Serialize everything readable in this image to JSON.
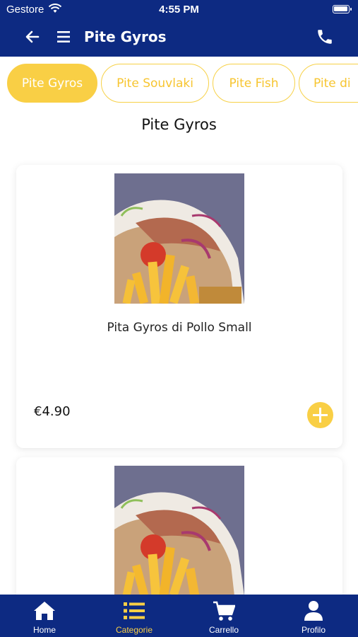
{
  "status_bar": {
    "carrier": "Gestore",
    "time": "4:55 PM"
  },
  "header": {
    "title": "Pite Gyros",
    "back_icon": "arrow-left-icon",
    "menu_icon": "hamburger-icon",
    "phone_icon": "phone-icon"
  },
  "tabs": [
    {
      "label": "Pite Gyros",
      "active": true
    },
    {
      "label": "Pite Souvlaki",
      "active": false
    },
    {
      "label": "Pite Fish",
      "active": false
    },
    {
      "label": "Pite di",
      "active": false
    }
  ],
  "section": {
    "title": "Pite Gyros"
  },
  "products": [
    {
      "name": "Pita Gyros di Pollo Small",
      "price": "€4.90"
    },
    {
      "name": "",
      "price": ""
    }
  ],
  "bottom_nav": [
    {
      "label": "Home",
      "icon": "home-icon",
      "active": false
    },
    {
      "label": "Categorie",
      "icon": "list-icon",
      "active": true
    },
    {
      "label": "Carrello",
      "icon": "cart-icon",
      "active": false
    },
    {
      "label": "Profilo",
      "icon": "user-icon",
      "active": false
    }
  ],
  "colors": {
    "primary": "#0d2a82",
    "accent": "#f9cf45"
  }
}
